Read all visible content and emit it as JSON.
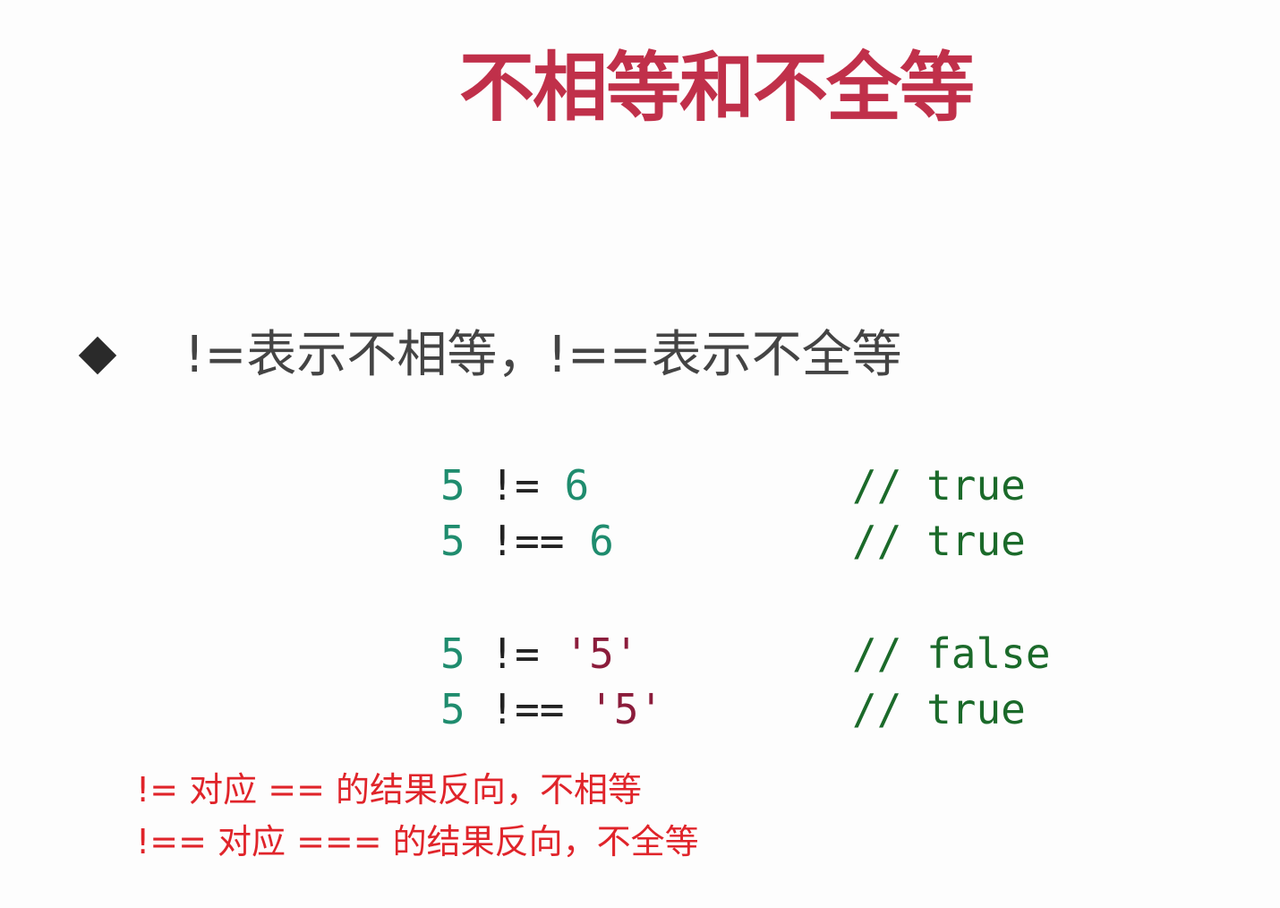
{
  "title": "不相等和不全等",
  "bullet": "!=表示不相等，!==表示不全等",
  "code": [
    {
      "left": "5",
      "op": "!=",
      "right": "6",
      "right_type": "num",
      "comment": "// true"
    },
    {
      "left": "5",
      "op": "!==",
      "right": "6",
      "right_type": "num",
      "comment": "// true"
    },
    {
      "left": "5",
      "op": "!=",
      "right": "'5'",
      "right_type": "str",
      "comment": "// false"
    },
    {
      "left": "5",
      "op": "!==",
      "right": "'5'",
      "right_type": "str",
      "comment": "// true"
    }
  ],
  "notes": [
    "!=  对应 == 的结果反向，不相等",
    "!== 对应 === 的结果反向，不全等"
  ],
  "colors": {
    "title": "#c0304a",
    "number": "#1f8c6e",
    "string": "#8b1c3b",
    "comment": "#1b6a2a",
    "note": "#e0242a"
  }
}
